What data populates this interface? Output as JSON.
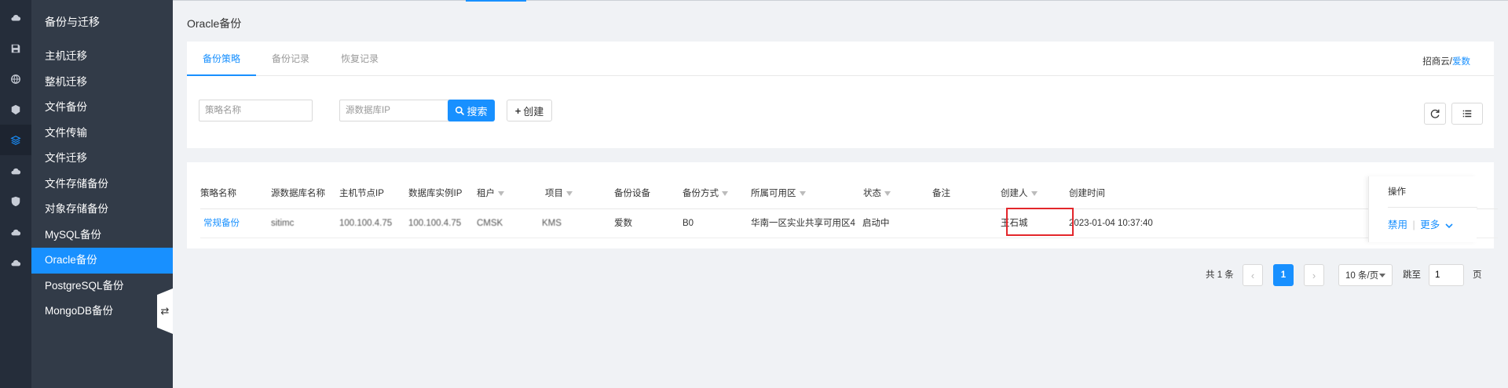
{
  "rail": {
    "icons": [
      "cloud-icon",
      "disk-icon",
      "globe-icon",
      "cube-icon",
      "layers-icon",
      "cloud-upload-icon",
      "shield-icon",
      "cloud-download-icon",
      "cloud-sync-icon"
    ]
  },
  "sidebar": {
    "title": "备份与迁移",
    "items": [
      {
        "label": "主机迁移"
      },
      {
        "label": "整机迁移"
      },
      {
        "label": "文件备份"
      },
      {
        "label": "文件传输"
      },
      {
        "label": "文件迁移"
      },
      {
        "label": "文件存储备份"
      },
      {
        "label": "对象存储备份"
      },
      {
        "label": "MySQL备份"
      },
      {
        "label": "Oracle备份"
      },
      {
        "label": "PostgreSQL备份"
      },
      {
        "label": "MongoDB备份"
      }
    ],
    "active_index": 8,
    "collapse_glyph": "⇄"
  },
  "page": {
    "title": "Oracle备份"
  },
  "tabs": [
    {
      "label": "备份策略"
    },
    {
      "label": "备份记录"
    },
    {
      "label": "恢复记录"
    }
  ],
  "breadcrumb": {
    "prefix": "招商云/",
    "link": "爱数"
  },
  "filters": {
    "policy_name_placeholder": "策略名称",
    "source_ip_placeholder": "源数据库IP"
  },
  "buttons": {
    "search": "搜索",
    "create": "创建"
  },
  "table": {
    "columns": [
      "策略名称",
      "源数据库名称",
      "主机节点IP",
      "数据库实例IP",
      "租户",
      "项目",
      "备份设备",
      "备份方式",
      "所属可用区",
      "状态",
      "备注",
      "创建人",
      "创建时间",
      "操作"
    ],
    "rows": [
      {
        "name": "常规备份",
        "db_name": "sitimc",
        "host_ip": "100.100.4.75",
        "instance_ip": "100.100.4.75",
        "tenant": "CMSK",
        "project": "KMS",
        "device": "爱数",
        "method": "B0",
        "zone": "华南一区实业共享可用区4",
        "status": "启动中",
        "remark": "",
        "creator": "王石城",
        "created": "2023-01-04 10:37:40",
        "op_disable": "禁用",
        "op_sep": "|",
        "op_more": "更多"
      }
    ]
  },
  "pagination": {
    "total": "共 1 条",
    "current": "1",
    "page_size": "10 条/页",
    "jump_label": "跳至",
    "jump_value": "1",
    "page_suffix": "页"
  },
  "colors": {
    "accent": "#1890ff",
    "sidebar": "#323b48",
    "rail": "#252d3a",
    "highlight": "#e3262b"
  }
}
